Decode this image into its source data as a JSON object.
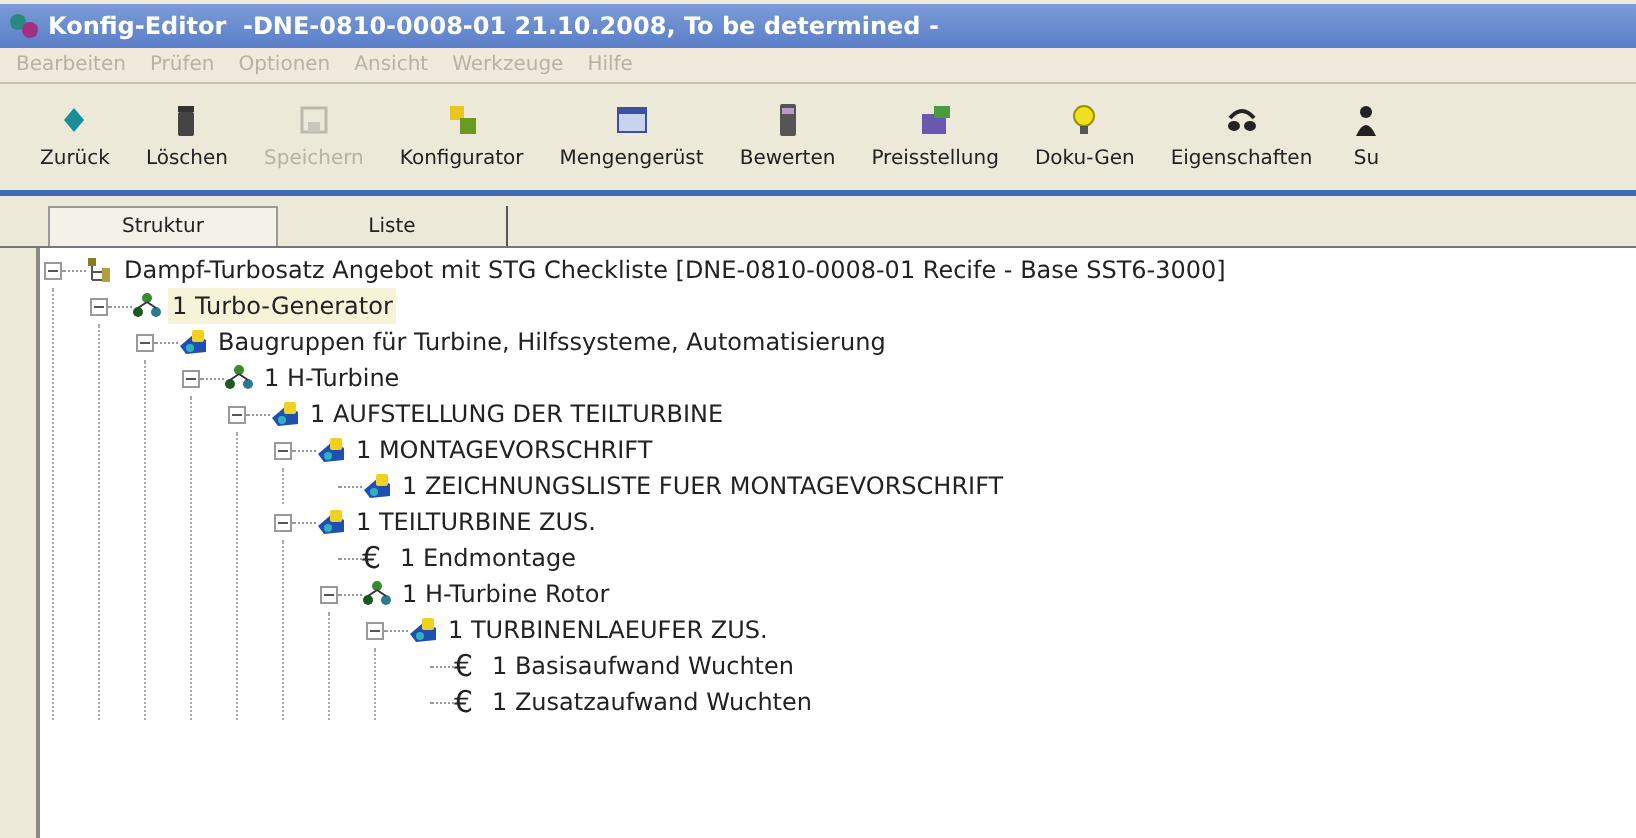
{
  "window": {
    "title": "Konfig-Editor  -DNE-0810-0008-01 21.10.2008, To be determined -"
  },
  "menu": [
    "Bearbeiten",
    "Prüfen",
    "Optionen",
    "Ansicht",
    "Werkzeuge",
    "Hilfe"
  ],
  "toolbar": [
    {
      "label": "Zurück",
      "kind": "back",
      "disabled": false
    },
    {
      "label": "Löschen",
      "kind": "delete",
      "disabled": false
    },
    {
      "label": "Speichern",
      "kind": "save",
      "disabled": true
    },
    {
      "label": "Konfigurator",
      "kind": "configurator",
      "disabled": false
    },
    {
      "label": "Mengengerüst",
      "kind": "table",
      "disabled": false
    },
    {
      "label": "Bewerten",
      "kind": "calculator",
      "disabled": false
    },
    {
      "label": "Preisstellung",
      "kind": "price",
      "disabled": false
    },
    {
      "label": "Doku-Gen",
      "kind": "bulb",
      "disabled": false
    },
    {
      "label": "Eigenschaften",
      "kind": "properties",
      "disabled": false
    },
    {
      "label": "Su",
      "kind": "search",
      "disabled": false
    }
  ],
  "tabs": [
    {
      "label": "Struktur",
      "selected": true
    },
    {
      "label": "Liste",
      "selected": false
    }
  ],
  "tree": [
    {
      "kind": "structure",
      "label": "Dampf-Turbosatz Angebot mit STG Checkliste [DNE-0810-0008-01 Recife - Base SST6-3000]",
      "selected": false,
      "expanded": true,
      "children": [
        {
          "kind": "assembly",
          "label": "1 Turbo-Generator",
          "selected": true,
          "expanded": true,
          "children": [
            {
              "kind": "module",
              "label": "Baugruppen für Turbine, Hilfssysteme, Automatisierung",
              "selected": false,
              "expanded": true,
              "children": [
                {
                  "kind": "assembly",
                  "label": "1 H-Turbine",
                  "selected": false,
                  "expanded": true,
                  "children": [
                    {
                      "kind": "module",
                      "label": "1 AUFSTELLUNG DER TEILTURBINE",
                      "selected": false,
                      "expanded": true,
                      "children": [
                        {
                          "kind": "module",
                          "label": "1 MONTAGEVORSCHRIFT",
                          "selected": false,
                          "expanded": true,
                          "children": [
                            {
                              "kind": "module",
                              "label": "1 ZEICHNUNGSLISTE FUER MONTAGEVORSCHRIFT",
                              "selected": false
                            }
                          ]
                        },
                        {
                          "kind": "module",
                          "label": "1 TEILTURBINE ZUS.",
                          "selected": false,
                          "expanded": true,
                          "children": [
                            {
                              "kind": "cost",
                              "marker": "€",
                              "label": "1 Endmontage",
                              "selected": false
                            },
                            {
                              "kind": "assembly",
                              "label": "1 H-Turbine Rotor",
                              "selected": false,
                              "expanded": true,
                              "children": [
                                {
                                  "kind": "module",
                                  "label": "1 TURBINENLAEUFER ZUS.",
                                  "selected": false,
                                  "expanded": true,
                                  "children": [
                                    {
                                      "kind": "cost",
                                      "marker": "€",
                                      "label": "1 Basisaufwand Wuchten",
                                      "selected": false
                                    },
                                    {
                                      "kind": "cost",
                                      "marker": "€",
                                      "label": "1 Zusatzaufwand Wuchten",
                                      "selected": false
                                    }
                                  ]
                                }
                              ]
                            }
                          ]
                        }
                      ]
                    }
                  ]
                }
              ]
            }
          ]
        }
      ]
    }
  ]
}
